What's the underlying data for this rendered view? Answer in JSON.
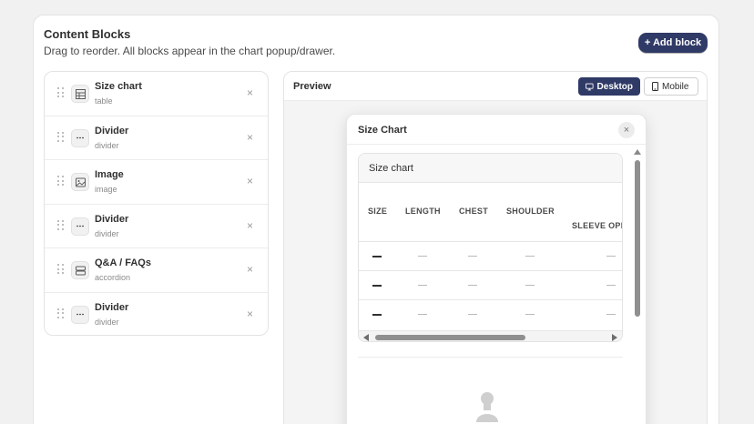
{
  "header": {
    "title": "Content Blocks",
    "subtitle": "Drag to reorder. All blocks appear in the chart popup/drawer.",
    "add_label": "+ Add block"
  },
  "blocks": [
    {
      "name": "Size chart",
      "type": "table",
      "icon": "table-icon"
    },
    {
      "name": "Divider",
      "type": "divider",
      "icon": "divider-icon"
    },
    {
      "name": "Image",
      "type": "image",
      "icon": "image-icon"
    },
    {
      "name": "Divider",
      "type": "divider",
      "icon": "divider-icon"
    },
    {
      "name": "Q&A / FAQs",
      "type": "accordion",
      "icon": "accordion-icon"
    },
    {
      "name": "Divider",
      "type": "divider",
      "icon": "divider-icon"
    }
  ],
  "block_remove_glyph": "×",
  "preview": {
    "title": "Preview",
    "desktop_label": "Desktop",
    "mobile_label": "Mobile",
    "modal_title": "Size Chart",
    "close_glyph": "×",
    "table": {
      "title": "Size chart",
      "columns": [
        "SIZE",
        "LENGTH",
        "CHEST",
        "SHOULDER",
        "SLEEVE OPI"
      ],
      "rows": [
        [
          "—",
          "—",
          "—",
          "—",
          "—"
        ],
        [
          "—",
          "—",
          "—",
          "—",
          "—"
        ],
        [
          "—",
          "—",
          "—",
          "—",
          "—"
        ]
      ]
    }
  },
  "colors": {
    "accent": "#303a66",
    "background": "#f1f1f1"
  }
}
